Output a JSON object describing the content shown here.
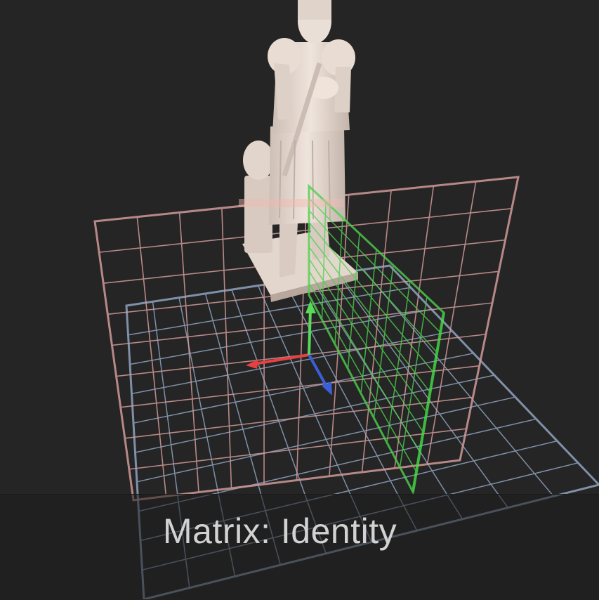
{
  "caption": {
    "matrix_label": "Matrix: Identity"
  },
  "colors": {
    "background": "#252525",
    "grid_xz": "#8fa3bf",
    "grid_xy": "#d29a9a",
    "grid_yz": "#4fd04f",
    "axis_x": "#e84040",
    "axis_y": "#5ad85a",
    "axis_z": "#3a5fd8",
    "statue": "#e9dcd3"
  },
  "scene": {
    "object": "statue-model",
    "gizmo_axes": [
      "x",
      "y",
      "z"
    ]
  }
}
